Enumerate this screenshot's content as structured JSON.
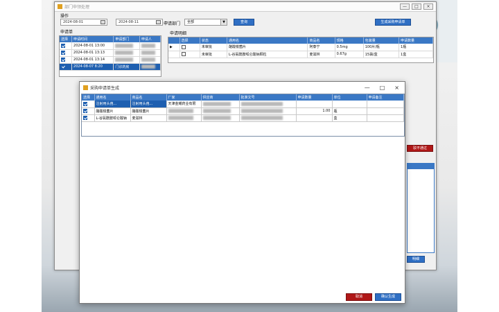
{
  "main_window": {
    "title": "部门申领处理",
    "controls": [
      "—",
      "□",
      "×"
    ]
  },
  "ops": {
    "label": "操作",
    "date_from": "2024-08-01",
    "tilde": "~",
    "date_to": "2024-08-11",
    "dept_label": "申请部门",
    "dept_value": "全部",
    "query_button": "查询",
    "batch_button": "生成采购申请单"
  },
  "left_panel": {
    "label": "申请单",
    "columns": [
      "选择",
      "申请时间",
      "申请部门",
      "申请人"
    ],
    "rows": [
      {
        "checked": true,
        "time": "2024-08-01 13:00",
        "dept": "",
        "user": ""
      },
      {
        "checked": true,
        "time": "2024-08-01 13:13",
        "dept": "",
        "user": ""
      },
      {
        "checked": true,
        "time": "2024-08-01 13:14",
        "dept": "",
        "user": ""
      },
      {
        "checked": true,
        "time": "2024-08-07 8:20",
        "dept": "门诊药房",
        "user": "",
        "selected": true
      }
    ]
  },
  "right_panel": {
    "label": "申请明细",
    "columns": [
      "选择",
      "状态",
      "通用名",
      "商品名",
      "规格",
      "包装量",
      "申请数量"
    ],
    "rows": [
      {
        "checked": false,
        "status": "未审批",
        "generic": "酪酸梭菌片",
        "brand": "阿泰宁",
        "spec": "0.5mg",
        "pack": "100片/瓶",
        "qty": "1瓶"
      },
      {
        "checked": false,
        "status": "未审批",
        "generic": "L-谷氨酰胺呱仑酸钠颗粒",
        "brand": "麦滋林",
        "spec": "0.67g",
        "pack": "15袋/盒",
        "qty": "1盒"
      }
    ],
    "reject_button": "驳不通过",
    "bottom_button": "明细"
  },
  "dialog": {
    "title": "采购申请单生成",
    "controls": [
      "—",
      "□",
      "×"
    ],
    "columns": [
      "选择",
      "通用名",
      "商品名",
      "厂家",
      "供应商",
      "批准文号",
      "申请数量",
      "单位",
      "申请备注"
    ],
    "rows": [
      {
        "checked": true,
        "generic": "注射用头孢...",
        "brand": "注射用头孢...",
        "maker": "天津金耀药业有限",
        "qty": "",
        "unit": "",
        "note": "",
        "highlight": true
      },
      {
        "checked": true,
        "generic": "酪酸梭菌片",
        "brand": "酪酸梭菌片",
        "maker": "",
        "qty": "1.00",
        "unit": "瓶",
        "note": ""
      },
      {
        "checked": true,
        "generic": "L-谷氨酰胺呱仑酸钠",
        "brand": "麦滋林",
        "maker": "",
        "qty": "",
        "unit": "盒",
        "note": ""
      }
    ],
    "cancel_button": "取消",
    "confirm_button": "确认生成"
  },
  "colors": {
    "header_blue": "#3a78c5",
    "select_blue": "#1e5fb0",
    "danger_red": "#b01818"
  }
}
